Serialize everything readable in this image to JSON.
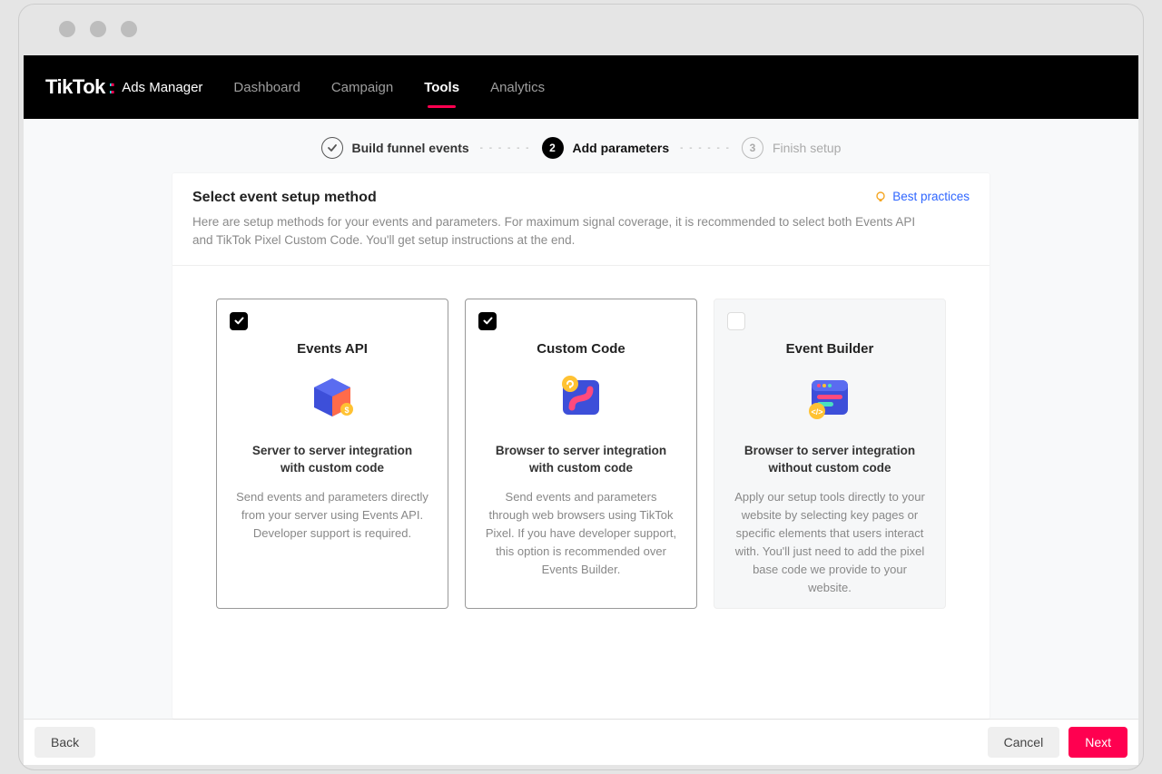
{
  "brand": {
    "logo": "TikTok",
    "sub": "Ads Manager"
  },
  "nav": {
    "items": [
      {
        "label": "Dashboard",
        "active": false
      },
      {
        "label": "Campaign",
        "active": false
      },
      {
        "label": "Tools",
        "active": true
      },
      {
        "label": "Analytics",
        "active": false
      }
    ]
  },
  "stepper": {
    "step1": {
      "label": "Build funnel events"
    },
    "step2": {
      "num": "2",
      "label": "Add parameters"
    },
    "step3": {
      "num": "3",
      "label": "Finish setup"
    }
  },
  "panel": {
    "title": "Select event setup method",
    "desc": "Here are setup methods for your events and parameters. For maximum signal coverage, it is recommended to select both Events API and TikTok Pixel Custom Code. You'll get setup instructions at the end.",
    "best_practices": "Best practices"
  },
  "cards": [
    {
      "checked": true,
      "title": "Events API",
      "subtitle": "Server to server integration with custom code",
      "body": "Send events and parameters directly from your server using Events API. Developer support is required."
    },
    {
      "checked": true,
      "title": "Custom Code",
      "subtitle": "Browser to server integration with custom code",
      "body": "Send events and parameters through web browsers using TikTok Pixel. If you have developer support, this option is recommended over Events Builder."
    },
    {
      "checked": false,
      "title": "Event Builder",
      "subtitle": "Browser to server integration without custom code",
      "body": "Apply our setup tools directly to your website by selecting key pages or specific elements that users interact with. You'll just need to add the pixel base code we provide to your website."
    }
  ],
  "footer": {
    "back": "Back",
    "cancel": "Cancel",
    "next": "Next"
  }
}
